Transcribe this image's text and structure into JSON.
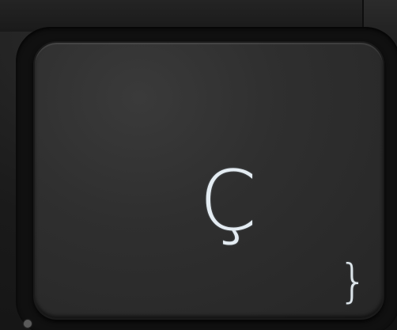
{
  "key": {
    "main_legend": "Ç",
    "alt_legend": "}"
  },
  "colors": {
    "key_surface": "#2f2f2f",
    "legend": "#e4ecf2",
    "deck": "#1a1a1a"
  }
}
